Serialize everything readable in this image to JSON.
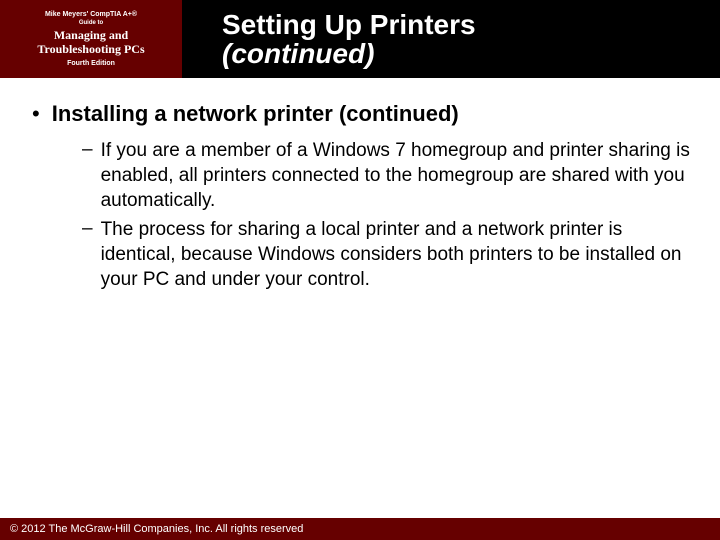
{
  "header": {
    "book": {
      "line1": "Mike Meyers' CompTIA A+®",
      "line2": "Guide to",
      "line3": "Managing and",
      "line4": "Troubleshooting PCs",
      "line5": "Fourth Edition"
    },
    "title": {
      "line1": "Setting Up Printers",
      "line2": "(continued)"
    }
  },
  "content": {
    "bullet1": "Installing a network printer (continued)",
    "sub1": "If you are a member of a Windows 7 homegroup and printer sharing is enabled, all printers connected to the homegroup are shared with you automatically.",
    "sub2": "The process for sharing a local printer and a network printer is identical, because Windows considers both printers to be installed on your PC and under your control."
  },
  "footer": {
    "copyright": "© 2012 The McGraw-Hill Companies, Inc. All rights reserved"
  }
}
